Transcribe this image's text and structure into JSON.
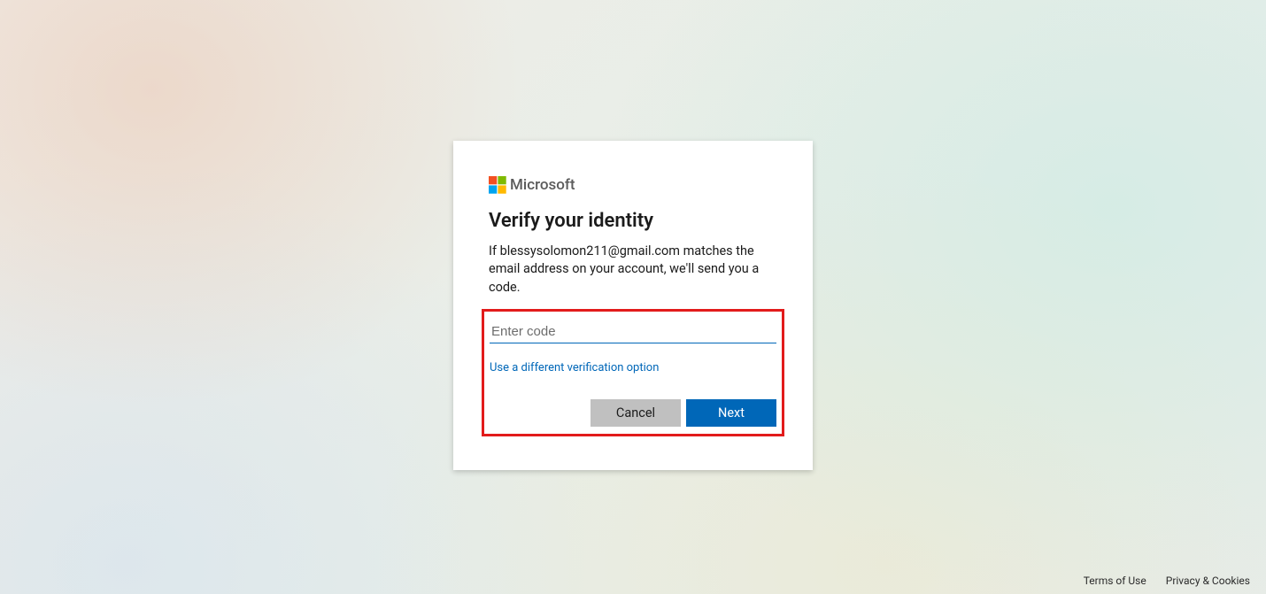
{
  "brand": {
    "name": "Microsoft"
  },
  "card": {
    "title": "Verify your identity",
    "description": "If blessysolomon211@gmail.com matches the email address on your account, we'll send you a code.",
    "code_placeholder": "Enter code",
    "code_value": "",
    "alt_link": "Use a different verification option",
    "cancel_label": "Cancel",
    "next_label": "Next"
  },
  "footer": {
    "terms": "Terms of Use",
    "privacy": "Privacy & Cookies"
  },
  "colors": {
    "primary": "#0067b8",
    "highlight_border": "#e21b1b"
  }
}
